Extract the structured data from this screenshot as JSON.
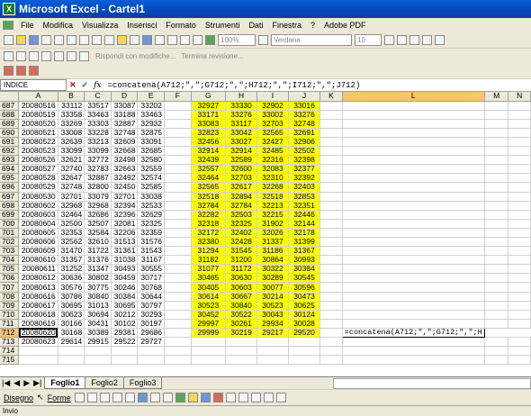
{
  "window": {
    "title": "Microsoft Excel - Cartel1",
    "app_icon": "excel-icon"
  },
  "menu": [
    "File",
    "Modifica",
    "Visualizza",
    "Inserisci",
    "Formato",
    "Strumenti",
    "Dati",
    "Finestra",
    "?",
    "Adobe PDF"
  ],
  "toolbar": {
    "zoom": "100%",
    "font": "Verdana",
    "font_size": "10",
    "review_label": "Rispondi con modifiche...",
    "end_review_label": "Termina revisione..."
  },
  "formula_bar": {
    "name_box": "INDICE",
    "fx_label": "fx",
    "formula": "=concatena(A712;\",\";G712;\",\";H712;\",\";I712;\",\";J712)"
  },
  "columns": [
    "A",
    "B",
    "C",
    "D",
    "E",
    "F",
    "G",
    "H",
    "I",
    "J",
    "K",
    "L",
    "M",
    "N"
  ],
  "rows": [
    {
      "n": "687",
      "a": "20080516",
      "b": "33112",
      "c": "33517",
      "d": "33087",
      "e": "33202",
      "g": "32927",
      "h": "33330",
      "i": "32902",
      "j": "33016"
    },
    {
      "n": "688",
      "a": "20080519",
      "b": "33358",
      "c": "33463",
      "d": "33188",
      "e": "33463",
      "g": "33171",
      "h": "33276",
      "i": "33002",
      "j": "33276"
    },
    {
      "n": "689",
      "a": "20080520",
      "b": "33269",
      "c": "33303",
      "d": "32887",
      "e": "32932",
      "g": "33083",
      "h": "33117",
      "i": "32703",
      "j": "32748"
    },
    {
      "n": "690",
      "a": "20080521",
      "b": "33008",
      "c": "33228",
      "d": "32748",
      "e": "32875",
      "g": "32823",
      "h": "33042",
      "i": "32565",
      "j": "32691"
    },
    {
      "n": "691",
      "a": "20080522",
      "b": "32639",
      "c": "33213",
      "d": "32609",
      "e": "33091",
      "g": "32456",
      "h": "33027",
      "i": "32427",
      "j": "32906"
    },
    {
      "n": "692",
      "a": "20080523",
      "b": "33099",
      "c": "33099",
      "d": "32668",
      "e": "32685",
      "g": "32914",
      "h": "32914",
      "i": "32485",
      "j": "32502"
    },
    {
      "n": "693",
      "a": "20080526",
      "b": "32621",
      "c": "32772",
      "d": "32498",
      "e": "32580",
      "g": "32439",
      "h": "32589",
      "i": "32316",
      "j": "32398"
    },
    {
      "n": "694",
      "a": "20080527",
      "b": "32740",
      "c": "32783",
      "d": "32663",
      "e": "32559",
      "g": "32557",
      "h": "32600",
      "i": "32083",
      "j": "32377"
    },
    {
      "n": "695",
      "a": "20080528",
      "b": "32647",
      "c": "32887",
      "d": "32492",
      "e": "32574",
      "g": "32464",
      "h": "32703",
      "i": "32310",
      "j": "32392"
    },
    {
      "n": "696",
      "a": "20080529",
      "b": "32748",
      "c": "32800",
      "d": "32450",
      "e": "32585",
      "g": "32565",
      "h": "32617",
      "i": "32268",
      "j": "32403"
    },
    {
      "n": "697",
      "a": "20080530",
      "b": "32701",
      "c": "33079",
      "d": "32701",
      "e": "33038",
      "g": "32518",
      "h": "32894",
      "i": "32518",
      "j": "32853"
    },
    {
      "n": "698",
      "a": "20080602",
      "b": "32968",
      "c": "32968",
      "d": "32394",
      "e": "32533",
      "g": "32784",
      "h": "32784",
      "i": "32213",
      "j": "32351"
    },
    {
      "n": "699",
      "a": "20080603",
      "b": "32464",
      "c": "32686",
      "d": "32396",
      "e": "32629",
      "g": "32282",
      "h": "32503",
      "i": "32215",
      "j": "32446"
    },
    {
      "n": "700",
      "a": "20080604",
      "b": "32500",
      "c": "32507",
      "d": "32081",
      "e": "32325",
      "g": "32318",
      "h": "32325",
      "i": "31902",
      "j": "32144"
    },
    {
      "n": "701",
      "a": "20080605",
      "b": "32353",
      "c": "32584",
      "d": "32206",
      "e": "32359",
      "g": "32172",
      "h": "32402",
      "i": "32026",
      "j": "32178"
    },
    {
      "n": "702",
      "a": "20080606",
      "b": "32562",
      "c": "32610",
      "d": "31513",
      "e": "31576",
      "g": "32380",
      "h": "32428",
      "i": "31337",
      "j": "31399"
    },
    {
      "n": "703",
      "a": "20080609",
      "b": "31470",
      "c": "31722",
      "d": "31361",
      "e": "31543",
      "g": "31294",
      "h": "31545",
      "i": "31186",
      "j": "31367"
    },
    {
      "n": "704",
      "a": "20080610",
      "b": "31357",
      "c": "31376",
      "d": "31038",
      "e": "31167",
      "g": "31182",
      "h": "31200",
      "i": "30864",
      "j": "30993"
    },
    {
      "n": "705",
      "a": "20080611",
      "b": "31252",
      "c": "31347",
      "d": "30493",
      "e": "30555",
      "g": "31077",
      "h": "31172",
      "i": "30322",
      "j": "30384"
    },
    {
      "n": "706",
      "a": "20080612",
      "b": "30636",
      "c": "30802",
      "d": "30459",
      "e": "30717",
      "g": "30465",
      "h": "30630",
      "i": "30289",
      "j": "30545"
    },
    {
      "n": "707",
      "a": "20080613",
      "b": "30576",
      "c": "30775",
      "d": "30246",
      "e": "30768",
      "g": "30405",
      "h": "30603",
      "i": "30077",
      "j": "30596"
    },
    {
      "n": "708",
      "a": "20080616",
      "b": "30786",
      "c": "30840",
      "d": "30384",
      "e": "30644",
      "g": "30614",
      "h": "30667",
      "i": "30214",
      "j": "30473"
    },
    {
      "n": "709",
      "a": "20080617",
      "b": "30695",
      "c": "31013",
      "d": "30695",
      "e": "30797",
      "g": "30523",
      "h": "30840",
      "i": "30523",
      "j": "30625"
    },
    {
      "n": "710",
      "a": "20080618",
      "b": "30623",
      "c": "30694",
      "d": "30212",
      "e": "30293",
      "g": "30452",
      "h": "30522",
      "i": "30043",
      "j": "30124"
    },
    {
      "n": "711",
      "a": "20080619",
      "b": "30166",
      "c": "30431",
      "d": "30102",
      "e": "30197",
      "g": "29997",
      "h": "30261",
      "i": "29934",
      "j": "30028"
    },
    {
      "n": "712",
      "a": "20080620",
      "b": "30168",
      "c": "30389",
      "d": "29381",
      "e": "29686",
      "g": "29999",
      "h": "30219",
      "i": "29217",
      "j": "29520"
    },
    {
      "n": "713",
      "a": "20080623",
      "b": "29614",
      "c": "29915",
      "d": "29522",
      "e": "29727",
      "g": "",
      "h": "",
      "i": "",
      "j": ""
    },
    {
      "n": "714",
      "a": "",
      "b": "",
      "c": "",
      "d": "",
      "e": "",
      "g": "",
      "h": "",
      "i": "",
      "j": ""
    },
    {
      "n": "715",
      "a": "",
      "b": "",
      "c": "",
      "d": "",
      "e": "",
      "g": "",
      "h": "",
      "i": "",
      "j": ""
    }
  ],
  "edit_cell_text": "=concatena(A712;\",\";G712;\",\";H",
  "sheet_tabs": [
    "Foglio1",
    "Foglio2",
    "Foglio3"
  ],
  "draw_bar": {
    "draw_label": "Disegno",
    "shapes_label": "Forme"
  },
  "status": "Invio",
  "colors": {
    "highlight": "#ffff00",
    "title_bar": "#0a5fd8"
  }
}
